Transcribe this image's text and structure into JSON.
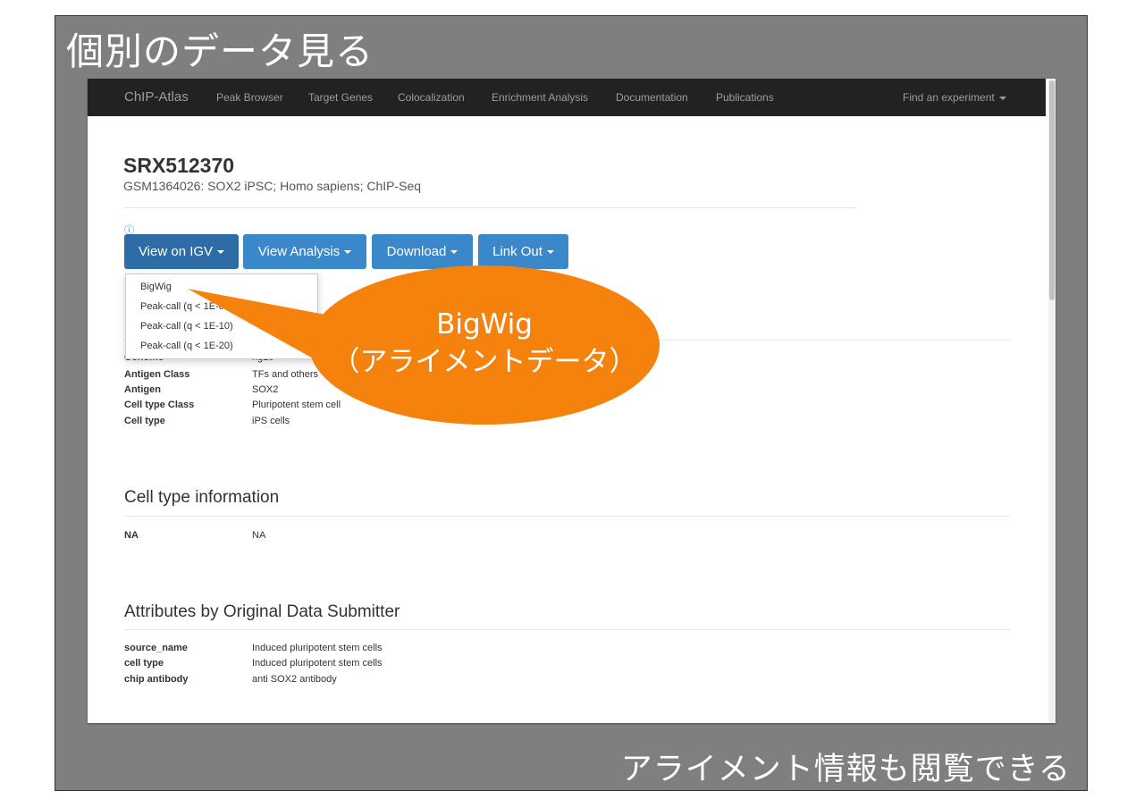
{
  "slide": {
    "title": "個別のデータ見る",
    "caption": "アライメント情報も閲覧できる"
  },
  "navbar": {
    "brand": "ChIP-Atlas",
    "links": [
      "Peak Browser",
      "Target Genes",
      "Colocalization",
      "Enrichment Analysis",
      "Documentation",
      "Publications"
    ],
    "find_experiment": "Find an experiment"
  },
  "experiment": {
    "id": "SRX512370",
    "subtitle": "GSM1364026: SOX2 iPSC; Homo sapiens; ChIP-Seq",
    "info_icon": "info-circle-icon"
  },
  "buttons": {
    "view_on_igv": "View on IGV",
    "view_analysis": "View Analysis",
    "download": "Download",
    "link_out": "Link Out"
  },
  "igv_menu": {
    "items": [
      "BigWig",
      "Peak-call (q < 1E-05)",
      "Peak-call (q < 1E-10)",
      "Peak-call (q < 1E-20)"
    ]
  },
  "sample_info": {
    "rows": [
      {
        "key": "Genome",
        "value": "hg19"
      },
      {
        "key": "Antigen Class",
        "value": "TFs and others"
      },
      {
        "key": "Antigen",
        "value": "SOX2"
      },
      {
        "key": "Cell type Class",
        "value": "Pluripotent stem cell"
      },
      {
        "key": "Cell type",
        "value": "iPS cells"
      }
    ]
  },
  "cell_type_info": {
    "heading": "Cell type information",
    "rows": [
      {
        "key": "NA",
        "value": "NA"
      }
    ]
  },
  "attributes": {
    "heading": "Attributes by Original Data Submitter",
    "rows": [
      {
        "key": "source_name",
        "value": "Induced pluripotent stem cells"
      },
      {
        "key": "cell type",
        "value": "Induced pluripotent stem cells"
      },
      {
        "key": "chip antibody",
        "value": "anti SOX2 antibody"
      }
    ]
  },
  "callout": {
    "line1": "BigWig",
    "line2": "（アライメントデータ）",
    "color": "#f5820c"
  },
  "colors": {
    "navbar_bg": "#222222",
    "button_primary": "#3a88c9",
    "button_active": "#2d6ca7",
    "slide_bg": "#7f7f7f"
  }
}
